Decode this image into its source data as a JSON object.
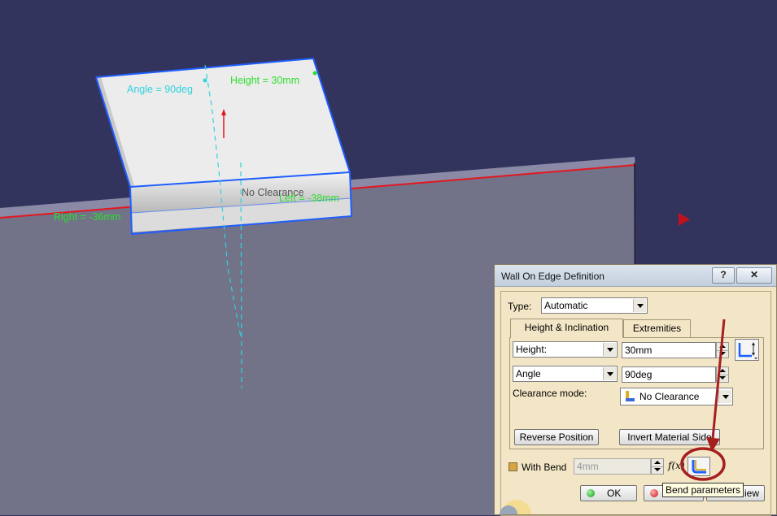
{
  "viewport": {
    "annotations": {
      "angle": "Angle = 90deg",
      "height": "Height = 30mm",
      "no_clearance": "No Clearance",
      "left": "Left = -38mm",
      "right": "Right = -36mm"
    },
    "colors": {
      "background": "#33345e",
      "plate": "#727289",
      "wall": "#ececec",
      "selection_blue": "#1f5fff",
      "edge_red": "#e4171f",
      "annotation_green": "#2ddf2d",
      "annotation_cyan": "#2fd3dd"
    }
  },
  "dialog": {
    "title": "Wall On Edge Definition",
    "help_label": "?",
    "close_label": "✕",
    "type_label": "Type:",
    "type_value": "Automatic",
    "tabs": [
      "Height & Inclination",
      "Extremities"
    ],
    "height_mode": "Height:",
    "height_value": "30mm",
    "angle_mode": "Angle",
    "angle_value": "90deg",
    "clearance_label": "Clearance mode:",
    "clearance_value": "No Clearance",
    "reverse_position": "Reverse Position",
    "invert_material_side": "Invert Material Side",
    "with_bend_label": "With Bend",
    "bend_radius_value": "4mm",
    "fx_label": "f(x)",
    "ok_label": "OK",
    "cancel_label": "Cancel",
    "preview_label": "Preview",
    "preview_visible": "iew",
    "tooltip": "Bend parameters"
  }
}
